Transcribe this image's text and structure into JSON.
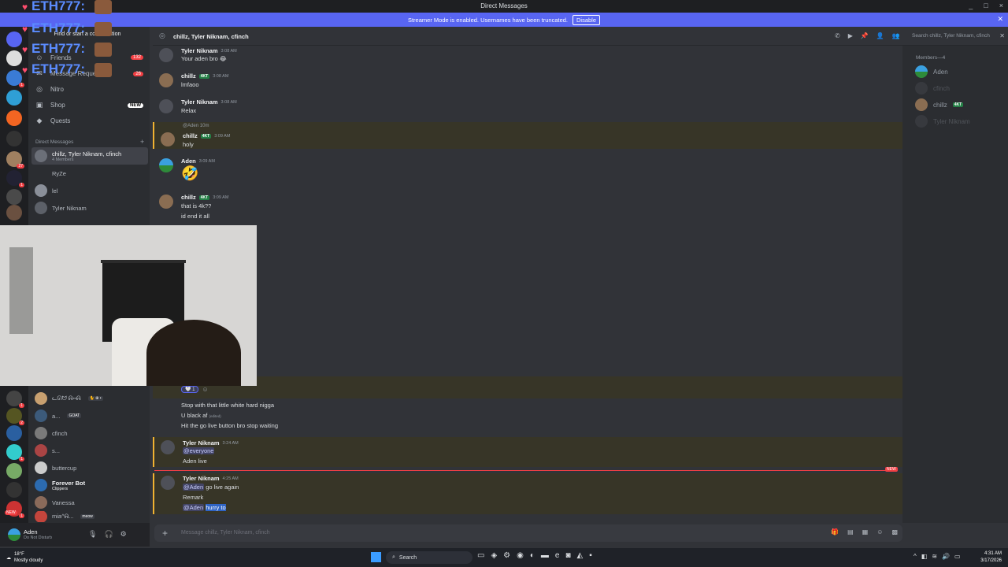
{
  "window": {
    "title": "Direct Messages",
    "controls": [
      "_",
      "□",
      "×"
    ]
  },
  "banner": {
    "text": "Streamer Mode is enabled. Usernames have been truncated.",
    "button": "Disable"
  },
  "overlay": {
    "text": "ETH777:"
  },
  "sidebar": {
    "find": "Find or start a conversation",
    "nav": [
      {
        "label": "Friends",
        "badge": "132"
      },
      {
        "label": "Message Requests",
        "badge": "26"
      },
      {
        "label": "Nitro",
        "badge": ""
      },
      {
        "label": "Shop",
        "badge": "NEW"
      },
      {
        "label": "Quests",
        "badge": ""
      }
    ],
    "dm_header": "Direct Messages",
    "dms": [
      {
        "name": "chillz, Tyler Niknam, cfinch",
        "sub": "4 Members"
      },
      {
        "name": "RyZe",
        "sub": ""
      },
      {
        "name": "lel",
        "sub": ""
      },
      {
        "name": "Tyler Niknam",
        "sub": ""
      }
    ],
    "dms_lower": [
      {
        "name": "ᓚᘏᗢ ᕱ⑅ᕱ",
        "tag": "🐈 ⊕ •"
      },
      {
        "name": "a...",
        "tag": "GOAT"
      },
      {
        "name": "cfinch",
        "tag": ""
      },
      {
        "name": "s...",
        "tag": ""
      },
      {
        "name": "buttercup",
        "tag": ""
      },
      {
        "name": "Forever Bot",
        "tag": "Clippers"
      },
      {
        "name": "Vanessa",
        "tag": ""
      },
      {
        "name": "mia^ᕱ...",
        "tag": "meow"
      }
    ],
    "server_badges": [
      "1",
      "27",
      "1",
      "1",
      "2",
      "1",
      "1"
    ],
    "new_badge": "NEW"
  },
  "user": {
    "name": "Aden",
    "status": "Do Not Disturb"
  },
  "chat": {
    "title": "chillz, Tyler Niknam, cfinch",
    "search": "Search chillz, Tyler Niknam, cfinch",
    "placeholder": "Message chillz, Tyler Niknam, cfinch",
    "new_label": "NEW",
    "messages": [
      {
        "author": "Tyler Niknam",
        "time": "3:08 AM",
        "text": "Your aden bro 😂"
      },
      {
        "author": "chillz",
        "badge": "4KT",
        "time": "3:08 AM",
        "text": "lmfaoo"
      },
      {
        "author": "Tyler Niknam",
        "time": "3:08 AM",
        "text": "Relax"
      },
      {
        "reply": "@Aden 10m",
        "author": "chillz",
        "badge": "4KT",
        "time": "3:09 AM",
        "text": "holy"
      },
      {
        "author": "Aden",
        "time": "3:09 AM",
        "emoji": "🤣"
      },
      {
        "author": "chillz",
        "badge": "4KT",
        "time": "3:09 AM",
        "text": "that is 4k??",
        "text2": "id end it all"
      }
    ],
    "reaction_count": "1",
    "tail": [
      "Stop with that little white hard nigga",
      "U black af",
      "(edited)",
      "Hit the go live button bro stop waiting"
    ],
    "msg_everyone": {
      "author": "Tyler Niknam",
      "time": "3:24 AM",
      "mention": "@everyone",
      "text": "Aden live"
    },
    "msg_last": {
      "author": "Tyler Niknam",
      "time": "4:25 AM",
      "mention": "@Aden",
      "text": "go live again",
      "text2": "Remark",
      "mention2": "@Aden",
      "text3": "hurry to"
    }
  },
  "members": {
    "header": "Members—4",
    "list": [
      "Aden",
      "cfinch",
      "chillz",
      "Tyler Niknam"
    ],
    "badge": "4KT"
  },
  "taskbar": {
    "temp": "18°F",
    "weather": "Mostly cloudy",
    "search": "Search",
    "time": "4:31 AM",
    "date": "3/17/2026"
  }
}
